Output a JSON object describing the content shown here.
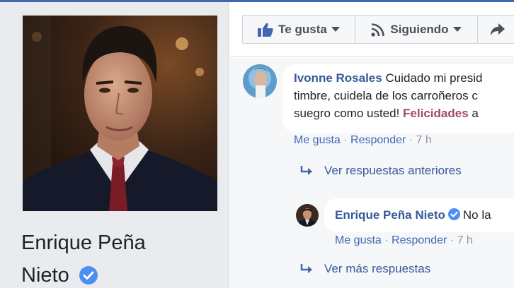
{
  "profile": {
    "name_line1": "Enrique Peña",
    "name_line2": "Nieto"
  },
  "actions": {
    "like_label": "Te gusta",
    "follow_label": "Siguiendo"
  },
  "comment": {
    "author": "Ivonne Rosales",
    "text_line1": "Cuidado mi presid",
    "text_line2": "timbre, cuidela de los carroñeros c",
    "text_line3_a": "suegro como usted!",
    "mention": "Felicidades",
    "text_line3_b": "a",
    "like": "Me gusta",
    "reply": "Responder",
    "time": "7 h",
    "previous_replies": "Ver respuestas anteriores"
  },
  "reply": {
    "author": "Enrique Peña Nieto",
    "text": "No la",
    "like": "Me gusta",
    "reply": "Responder",
    "time": "7 h",
    "more_replies": "Ver más respuestas"
  },
  "colors": {
    "facebook_blue": "#4267b2",
    "link": "#385898",
    "verified": "#4c8ff2",
    "mention": "#a2496b"
  }
}
